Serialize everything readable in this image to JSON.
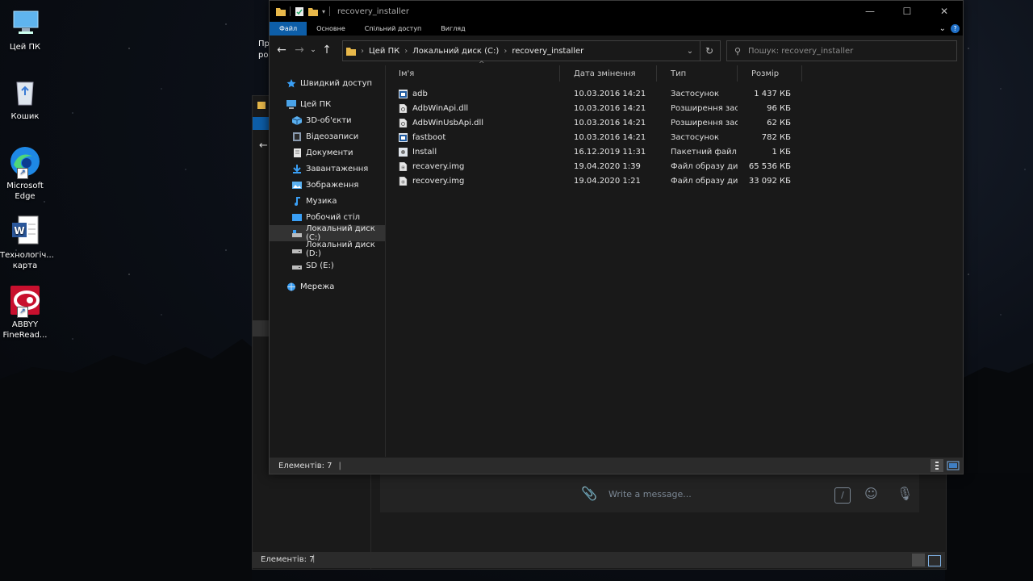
{
  "desktop": {
    "icons": [
      {
        "label": "Цей ПК",
        "icon": "this-pc-icon"
      },
      {
        "label": "Кошик",
        "icon": "recycle-bin-icon"
      },
      {
        "label": "Microsoft Edge",
        "icon": "edge-icon"
      },
      {
        "label": "Технологічна карта",
        "label_shown": "Технологіч... карта",
        "icon": "word-document-icon"
      },
      {
        "label": "ABBYY FineReader",
        "label_shown": "ABBYY FineRead...",
        "icon": "abbyy-icon"
      }
    ],
    "partial_text": "Пр\nроз"
  },
  "bg_window": {
    "status": "Елементів: 7",
    "chat_placeholder": "Write a message..."
  },
  "window": {
    "title": "recovery_installer",
    "ribbon_tabs": [
      "Файл",
      "Основне",
      "Спільний доступ",
      "Вигляд"
    ],
    "active_tab": "Файл",
    "breadcrumb": [
      "Цей ПК",
      "Локальний диск (C:)",
      "recovery_installer"
    ],
    "search_placeholder": "Пошук: recovery_installer",
    "nav": [
      {
        "label": "Швидкий доступ",
        "icon": "star-icon",
        "indent": 0
      },
      {
        "label": "Цей ПК",
        "icon": "this-pc-icon",
        "indent": 0
      },
      {
        "label": "3D-об'єкти",
        "icon": "cube-3d-icon",
        "indent": 1
      },
      {
        "label": "Відеозаписи",
        "icon": "video-folder-icon",
        "indent": 1
      },
      {
        "label": "Документи",
        "icon": "documents-icon",
        "indent": 1
      },
      {
        "label": "Завантаження",
        "icon": "download-icon",
        "indent": 1
      },
      {
        "label": "Зображення",
        "icon": "pictures-icon",
        "indent": 1
      },
      {
        "label": "Музика",
        "icon": "music-icon",
        "indent": 1
      },
      {
        "label": "Робочий стіл",
        "icon": "desktop-folder-icon",
        "indent": 1
      },
      {
        "label": "Локальний диск (C:)",
        "icon": "drive-c-icon",
        "indent": 1,
        "selected": true
      },
      {
        "label": "Локальний диск (D:)",
        "icon": "drive-icon",
        "indent": 1
      },
      {
        "label": "SD (E:)",
        "icon": "drive-icon",
        "indent": 1
      },
      {
        "label": "Мережа",
        "icon": "network-icon",
        "indent": 0
      }
    ],
    "columns": [
      "Ім'я",
      "Дата змінення",
      "Тип",
      "Розмір"
    ],
    "files": [
      {
        "name": "adb",
        "date": "10.03.2016 14:21",
        "type": "Застосунок",
        "size": "1 437 КБ",
        "icon": "exe-icon"
      },
      {
        "name": "AdbWinApi.dll",
        "date": "10.03.2016 14:21",
        "type": "Розширення заст...",
        "size": "96 КБ",
        "icon": "dll-icon"
      },
      {
        "name": "AdbWinUsbApi.dll",
        "date": "10.03.2016 14:21",
        "type": "Розширення заст...",
        "size": "62 КБ",
        "icon": "dll-icon"
      },
      {
        "name": "fastboot",
        "date": "10.03.2016 14:21",
        "type": "Застосунок",
        "size": "782 КБ",
        "icon": "exe-icon"
      },
      {
        "name": "Install",
        "date": "16.12.2019 11:31",
        "type": "Пакетний файл W...",
        "size": "1 КБ",
        "icon": "batch-file-icon"
      },
      {
        "name": "recavery.img",
        "date": "19.04.2020 1:39",
        "type": "Файл образу диска",
        "size": "65 536 КБ",
        "icon": "disk-image-icon"
      },
      {
        "name": "recovery.img",
        "date": "19.04.2020 1:21",
        "type": "Файл образу диска",
        "size": "33 092 КБ",
        "icon": "disk-image-icon"
      }
    ],
    "status": "Елементів: 7"
  }
}
